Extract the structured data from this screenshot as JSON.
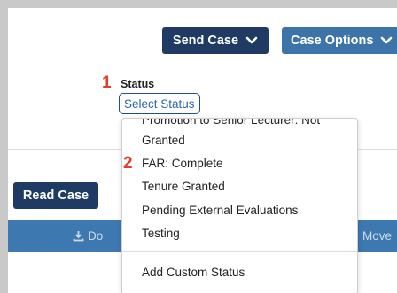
{
  "header": {
    "send_case_label": "Send Case",
    "case_options_label": "Case Options"
  },
  "markers": {
    "one": "1",
    "two": "2"
  },
  "status": {
    "label": "Status",
    "select_label": "Select Status"
  },
  "dropdown": {
    "options": [
      "Promotion to Senior Lecturer: Not",
      "Granted",
      "FAR: Complete",
      "Tenure Granted",
      "Pending External Evaluations",
      "Testing"
    ],
    "add_custom_label": "Add Custom Status"
  },
  "actions": {
    "read_case_label": "Read Case",
    "download_label": "Do",
    "move_label": "Move"
  },
  "icons": {
    "chevron": "chevron-down-icon",
    "download": "download-icon",
    "move": "move-icon"
  },
  "colors": {
    "navy": "#1f3a63",
    "blue": "#3c74a8",
    "toolbar": "#3d78b0",
    "marker": "#e0412c",
    "link": "#2f66a8"
  }
}
